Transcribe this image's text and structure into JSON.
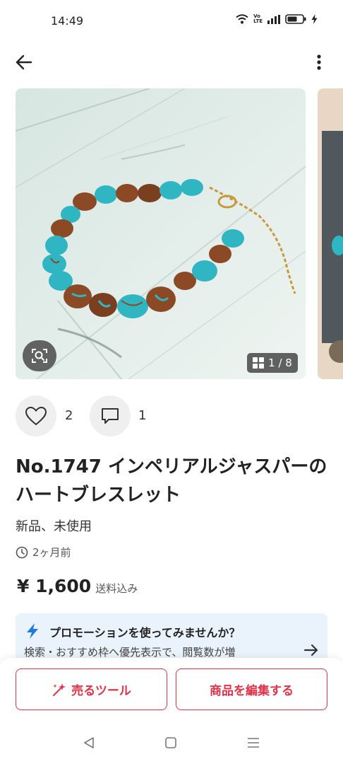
{
  "status_bar": {
    "time": "14:49",
    "volte_line1": "Vo",
    "volte_line2": "LTE",
    "icons": [
      "wifi-icon",
      "volte-icon",
      "signal-icon",
      "battery-icon",
      "charging-icon"
    ]
  },
  "nav": {
    "icons": [
      "back-arrow-icon",
      "more-vertical-icon"
    ]
  },
  "gallery": {
    "counter": "1 / 8",
    "current_index": 1,
    "total": 8
  },
  "reactions": {
    "likes": "2",
    "comments": "1"
  },
  "item": {
    "title": "No.1747 インペリアルジャスパーのハートブレスレット",
    "condition": "新品、未使用",
    "posted": "2ヶ月前",
    "price": "¥ 1,600",
    "shipping": "送料込み"
  },
  "promo": {
    "title": "プロモーションを使ってみませんか？",
    "body": "検索・おすすめ枠へ優先表示で、閲覧数が増"
  },
  "actions": {
    "tools_label": "売るツール",
    "edit_label": "商品を編集する"
  },
  "colors": {
    "accent": "#e0334a",
    "promo_bg": "#eaf3fc",
    "promo_icon": "#1f7be0",
    "turquoise": "#2fb6c2",
    "jasper": "#8b4a25"
  }
}
